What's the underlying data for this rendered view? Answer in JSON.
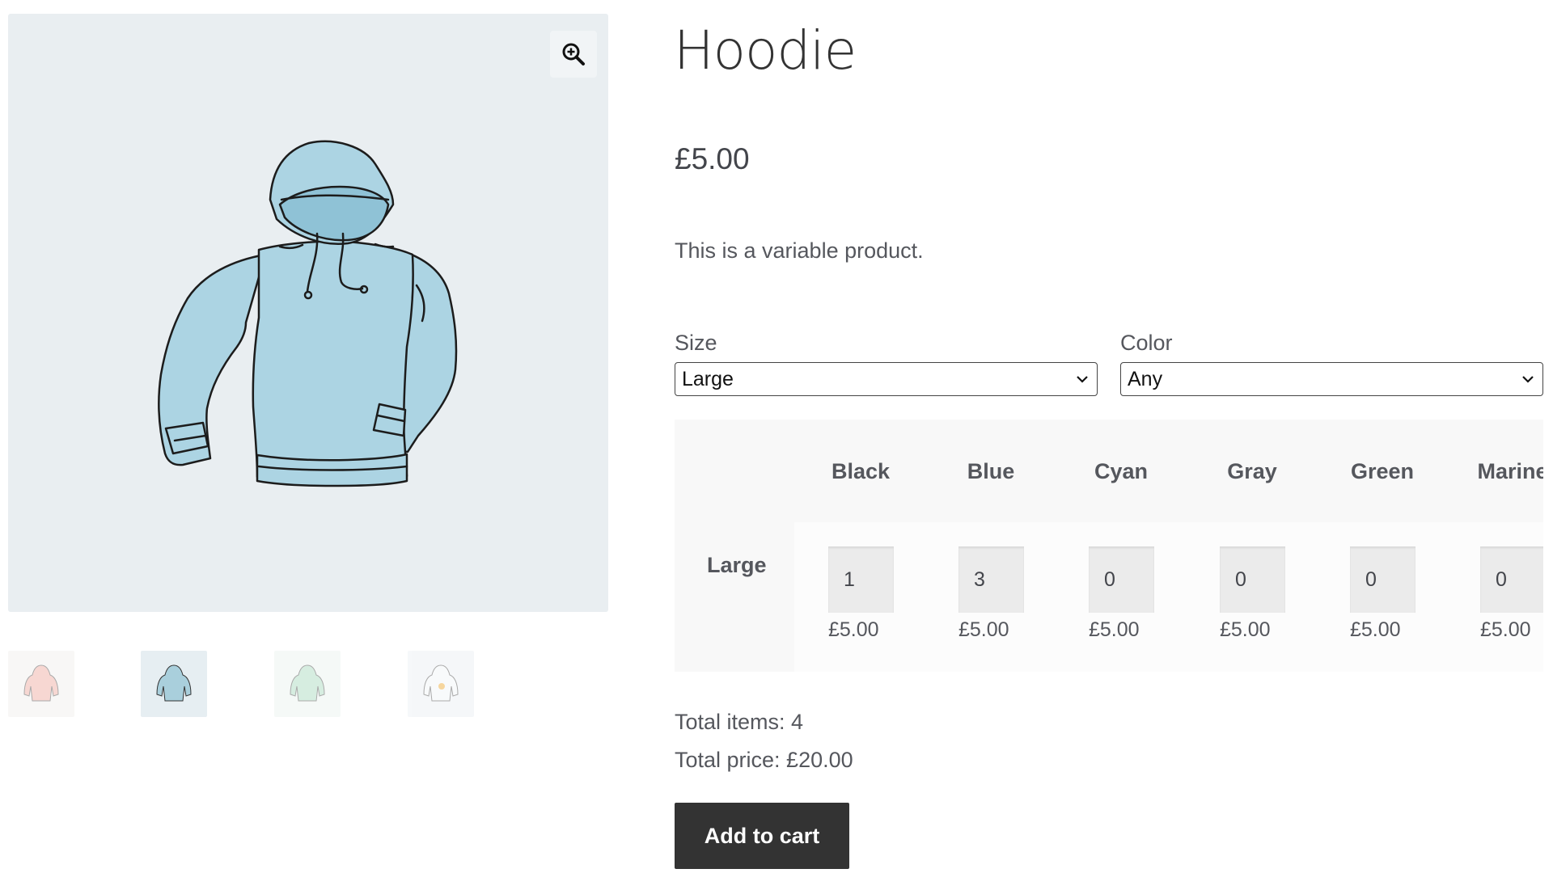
{
  "product": {
    "title": "Hoodie",
    "price": "£5.00",
    "description": "This is a variable product."
  },
  "gallery": {
    "zoom_icon": "zoom-in-magnifier-icon",
    "main_image": "blue-hoodie-illustration",
    "thumbnails": [
      {
        "name": "pink-hoodie-thumbnail",
        "color": "#f2c4bd"
      },
      {
        "name": "blue-hoodie-thumbnail",
        "color": "#a9cfdc",
        "selected": true
      },
      {
        "name": "green-hoodie-thumbnail",
        "color": "#bfe3cf"
      },
      {
        "name": "white-logo-hoodie-thumbnail",
        "color": "#e7eef3"
      }
    ]
  },
  "variations": {
    "size": {
      "label": "Size",
      "value": "Large"
    },
    "color": {
      "label": "Color",
      "value": "Any"
    }
  },
  "matrix": {
    "row_label": "Large",
    "columns": [
      {
        "name": "Black",
        "qty": "1",
        "price": "£5.00"
      },
      {
        "name": "Blue",
        "qty": "3",
        "price": "£5.00"
      },
      {
        "name": "Cyan",
        "qty": "0",
        "price": "£5.00"
      },
      {
        "name": "Gray",
        "qty": "0",
        "price": "£5.00"
      },
      {
        "name": "Green",
        "qty": "0",
        "price": "£5.00"
      },
      {
        "name": "Marine",
        "qty": "0",
        "price": "£5.00"
      }
    ]
  },
  "totals": {
    "items": "Total items: 4",
    "price": "Total price: £20.00"
  },
  "cart": {
    "button_label": "Add to cart"
  },
  "colors": {
    "image_bg": "#e9eef1",
    "hoodie_fill": "#a9d3e3",
    "button_bg": "#333333",
    "text": "#43454b"
  }
}
